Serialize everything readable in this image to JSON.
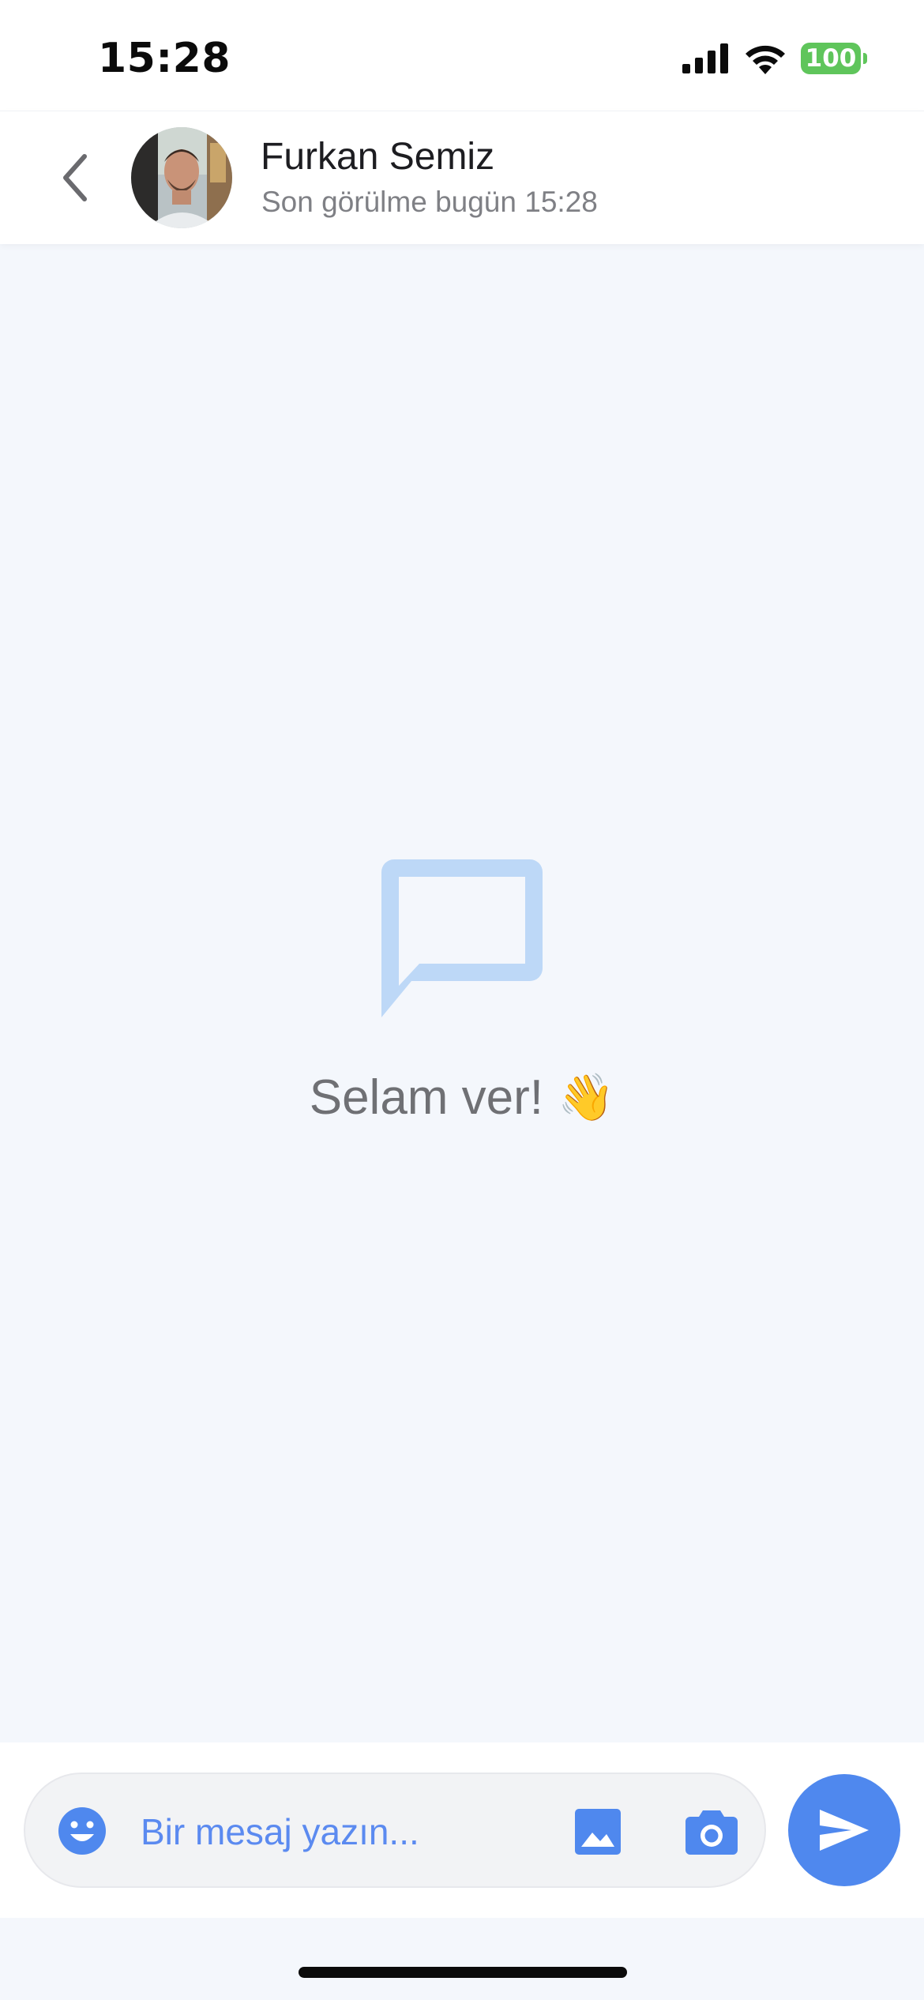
{
  "status_bar": {
    "time": "15:28",
    "battery_level": "100",
    "icons": [
      "cellular-signal-icon",
      "wifi-icon",
      "battery-icon"
    ]
  },
  "header": {
    "contact_name": "Furkan Semiz",
    "last_seen": "Son görülme bugün 15:28",
    "icons": [
      "back-chevron-icon",
      "avatar"
    ]
  },
  "empty_state": {
    "message": "Selam ver!",
    "emoji": "👋",
    "icon": "chat-bubble-icon"
  },
  "composer": {
    "placeholder": "Bir mesaj yazın...",
    "value": "",
    "icons": [
      "emoji-icon",
      "image-icon",
      "camera-icon",
      "send-icon"
    ]
  },
  "colors": {
    "accent": "#4f88ee",
    "background": "#f4f7fc",
    "battery": "#5fc55b",
    "empty_icon": "#bdd8f7",
    "muted_text": "#6f7074"
  }
}
